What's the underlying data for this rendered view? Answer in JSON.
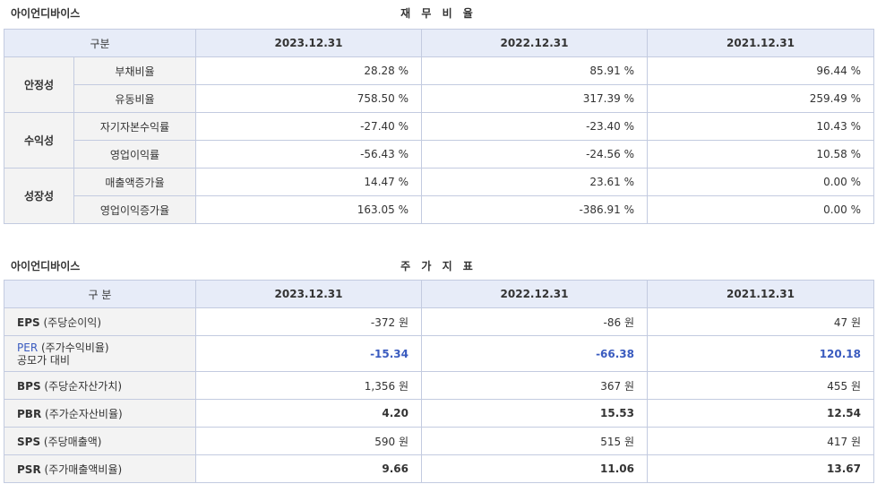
{
  "ratio_section": {
    "company": "아이언디바이스",
    "title": "재 무 비 율",
    "header": [
      "구분",
      "2023.12.31",
      "2022.12.31",
      "2021.12.31"
    ],
    "groups": [
      {
        "category": "안정성",
        "rows": [
          {
            "label": "부채비율",
            "values": [
              "28.28 %",
              "85.91 %",
              "96.44 %"
            ]
          },
          {
            "label": "유동비율",
            "values": [
              "758.50 %",
              "317.39 %",
              "259.49 %"
            ]
          }
        ]
      },
      {
        "category": "수익성",
        "rows": [
          {
            "label": "자기자본수익률",
            "values": [
              "-27.40 %",
              "-23.40 %",
              "10.43 %"
            ]
          },
          {
            "label": "영업이익률",
            "values": [
              "-56.43 %",
              "-24.56 %",
              "10.58 %"
            ]
          }
        ]
      },
      {
        "category": "성장성",
        "rows": [
          {
            "label": "매출액증가율",
            "values": [
              "14.47 %",
              "23.61 %",
              "0.00 %"
            ]
          },
          {
            "label": "영업이익증가율",
            "values": [
              "163.05 %",
              "-386.91 %",
              "0.00 %"
            ]
          }
        ]
      }
    ]
  },
  "stock_section": {
    "company": "아이언디바이스",
    "title": "주 가 지 표",
    "header": [
      "구 분",
      "2023.12.31",
      "2022.12.31",
      "2021.12.31"
    ],
    "rows": [
      {
        "code": "EPS",
        "desc": "(주당순이익)",
        "values": [
          "-372 원",
          "-86 원",
          "47 원"
        ]
      },
      {
        "code": "PER",
        "desc": "(주가수익비율)",
        "note": "공모가 대비",
        "values": [
          "-15.34",
          "-66.38",
          "120.18"
        ]
      },
      {
        "code": "BPS",
        "desc": "(주당순자산가치)",
        "values": [
          "1,356 원",
          "367 원",
          "455 원"
        ]
      },
      {
        "code": "PBR",
        "desc": "(주가순자산비율)",
        "values": [
          "4.20",
          "15.53",
          "12.54"
        ]
      },
      {
        "code": "SPS",
        "desc": "(주당매출액)",
        "values": [
          "590 원",
          "515 원",
          "417 원"
        ]
      },
      {
        "code": "PSR",
        "desc": "(주가매출액비율)",
        "values": [
          "9.66",
          "11.06",
          "13.67"
        ]
      }
    ]
  },
  "colors": {
    "header_bg": "#e7ecf8",
    "label_bg": "#f3f3f3",
    "border": "#c3cbe0",
    "accent_blue": "#3a5bbf"
  }
}
